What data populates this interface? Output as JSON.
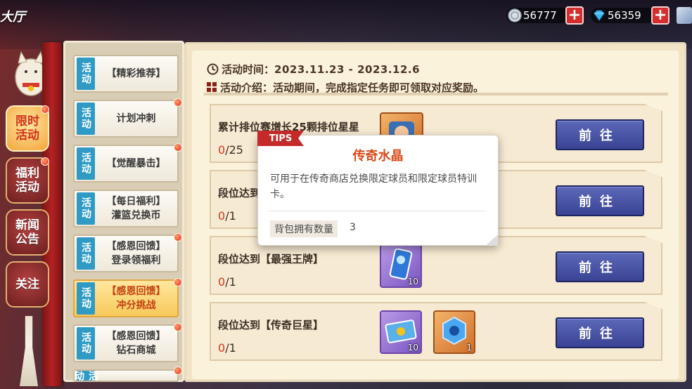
{
  "hall_title": "大厅",
  "currencies": [
    {
      "icon": "silver-coin-icon",
      "value": "56777"
    },
    {
      "icon": "diamond-icon",
      "value": "56359"
    }
  ],
  "main_tabs": [
    {
      "label": "限时\n活动",
      "active": true
    },
    {
      "label": "福利\n活动",
      "active": false
    },
    {
      "label": "新闻\n公告",
      "active": false
    },
    {
      "label": "关注",
      "active": false
    }
  ],
  "side_items": [
    {
      "tag": "活动",
      "label": "【精彩推荐】",
      "active": false,
      "dot": false
    },
    {
      "tag": "活动",
      "label": "计划冲刺",
      "active": false,
      "dot": true
    },
    {
      "tag": "活动",
      "label": "【觉醒暴击】",
      "active": false,
      "dot": true
    },
    {
      "tag": "活动",
      "label": "【每日福利】\n灌篮兑换币",
      "active": false,
      "dot": false
    },
    {
      "tag": "活动",
      "label": "【感恩回馈】\n登录领福利",
      "active": false,
      "dot": true
    },
    {
      "tag": "活动",
      "label": "【感恩回馈】\n冲分挑战",
      "active": true,
      "dot": true
    },
    {
      "tag": "活动",
      "label": "【感恩回馈】\n钻石商城",
      "active": false,
      "dot": true
    },
    {
      "tag": "活动",
      "label": "",
      "active": false,
      "dot": true
    }
  ],
  "activity": {
    "time_label": "活动时间：",
    "time_value": "2023.11.23 - 2023.12.6",
    "intro_label": "活动介绍：",
    "intro_value": "活动期间，完成指定任务即可领取对应奖励。"
  },
  "tasks": [
    {
      "title": "累计排位赛增长25颗排位星星",
      "current": "0",
      "total": "/25",
      "button": "前往"
    },
    {
      "title": "段位达到",
      "current": "0",
      "total": "/1",
      "button": "前往"
    },
    {
      "title": "段位达到【最强王牌】",
      "current": "0",
      "total": "/1",
      "button": "前往",
      "rewards": [
        {
          "count": "10"
        }
      ]
    },
    {
      "title": "段位达到【传奇巨星】",
      "current": "0",
      "total": "/1",
      "button": "前往",
      "rewards": [
        {
          "count": "10"
        },
        {
          "count": "1"
        }
      ]
    }
  ],
  "tooltip": {
    "tag": "TIPS",
    "title": "传奇水晶",
    "desc": "可用于在传奇商店兑换限定球员和限定球员特训卡。",
    "qty_label": "背包拥有数量",
    "qty_value": "3"
  }
}
